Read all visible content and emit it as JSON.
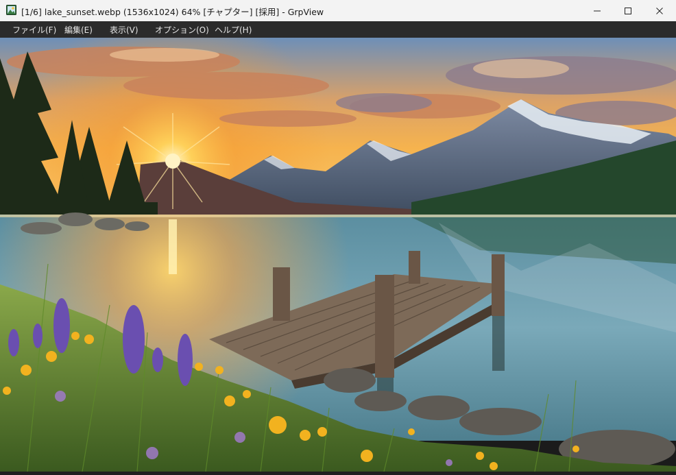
{
  "window": {
    "title": "[1/6] lake_sunset.webp (1536x1024) 64% [チャプター] [採用] - GrpView",
    "controls": [
      "minimize-icon",
      "maximize-icon",
      "close-icon"
    ]
  },
  "menu": {
    "file": "ファイル(F)",
    "edit": "編集(E)",
    "view": "表示(V)",
    "options": "オプション(O)",
    "help": "ヘルプ(H)"
  },
  "image": {
    "filename": "lake_sunset.webp",
    "subject": "sunset-lake-dock-mountains"
  },
  "colors": {
    "titlebar": "#f3f3f3",
    "menubar": "#2b2b2b",
    "menu_text": "#e6e6e6",
    "sun": "#ffd25a"
  }
}
